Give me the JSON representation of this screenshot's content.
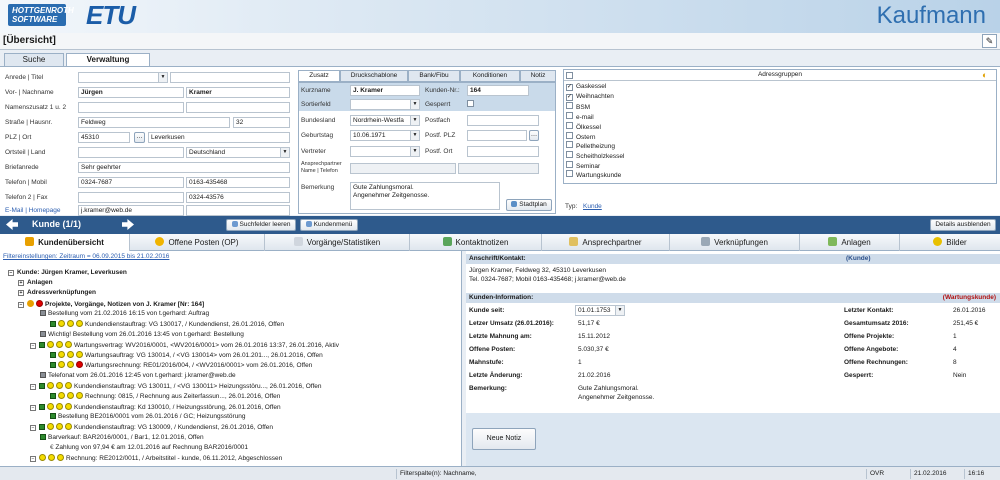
{
  "header": {
    "logo_line1": "HOTTGENROTH",
    "logo_line2": "SOFTWARE",
    "logo_main": "ETU",
    "app_title": "Kaufmann"
  },
  "titlebar": {
    "title": "[Übersicht]"
  },
  "tabs": [
    {
      "label": "Suche"
    },
    {
      "label": "Verwaltung"
    }
  ],
  "form": {
    "anrede_label": "Anrede | Titel",
    "name_label": "Vor- | Nachname",
    "vorname": "Jürgen",
    "nachname": "Kramer",
    "nz_label": "Namenszusatz 1 u. 2",
    "strasse_label": "Straße | Hausnr.",
    "strasse": "Feldweg",
    "hausnr": "32",
    "plz_label": "PLZ | Ort",
    "plz": "45310",
    "ort": "Leverkusen",
    "ortsteil_label": "Ortsteil | Land",
    "land": "Deutschland",
    "briefanrede_label": "Briefanrede",
    "briefanrede": "Sehr geehrter",
    "tel1_label": "Telefon | Mobil",
    "tel1": "0324-7687",
    "mobil": "0163-435468",
    "tel2_label": "Telefon 2 | Fax",
    "fax": "0324-43576",
    "email_label": "E-Mail | Homepage",
    "email": "j.kramer@web.de"
  },
  "mid": {
    "tabs": [
      "Zusatz",
      "Druckschablone",
      "Bank/Fibu",
      "Konditionen",
      "Notiz"
    ],
    "kurzname_label": "Kurzname",
    "kurzname": "J. Kramer",
    "kundennr_label": "Kunden-Nr.:",
    "kundennr": "164",
    "sortierfeld_label": "Sortierfeld",
    "gesperrt_label": "Gesperrt",
    "bundesland_label": "Bundesland",
    "bundesland": "Nordrhein-Westfa",
    "postfach_label": "Postfach",
    "geburtstag_label": "Geburtstag",
    "geburtstag": "10.06.1971",
    "postfplz_label": "Postf. PLZ",
    "vertreter_label": "Vertreter",
    "postfort_label": "Postf. Ort",
    "ansprech_label1": "Ansprechpartner",
    "ansprech_label2": "Name | Telefon",
    "bemerkung_label": "Bemerkung",
    "bemerkung1": "Gute Zahlungsmoral.",
    "bemerkung2": "Angenehmer Zeitgenosse.",
    "stadtplan": "Stadtplan"
  },
  "groups": {
    "title": "Adressgruppen",
    "items": [
      {
        "label": "Gaskessel",
        "checked": true
      },
      {
        "label": "Weihnachten",
        "checked": true
      },
      {
        "label": "BSM",
        "checked": false
      },
      {
        "label": "e-mail",
        "checked": false
      },
      {
        "label": "Ölkessel",
        "checked": false
      },
      {
        "label": "Ostern",
        "checked": false
      },
      {
        "label": "Pelletheizung",
        "checked": false
      },
      {
        "label": "Scheitholzkessel",
        "checked": false
      },
      {
        "label": "Seminar",
        "checked": false
      },
      {
        "label": "Wartungskunde",
        "checked": false
      }
    ],
    "typ_label": "Typ:",
    "typ_value": "Kunde"
  },
  "nav": {
    "kunde": "Kunde (1/1)",
    "clear": "Suchfelder leeren",
    "menu": "Kundenmenü",
    "details": "Details ausblenden"
  },
  "viewtabs": [
    "Kundenübersicht",
    "Offene Posten (OP)",
    "Vorgänge/Statistiken",
    "Kontaktnotizen",
    "Ansprechpartner",
    "Verknüpfungen",
    "Anlagen",
    "Bilder"
  ],
  "tree": {
    "filter": "Filtereinstellungen: Zeitraum = 06.09.2015 bis 21.02.2016",
    "root": "Kunde: Jürgen Kramer, Leverkusen",
    "lines": [
      "Anlagen",
      "Adressverknüpfungen",
      "Projekte, Vorgänge, Notizen von J. Kramer [Nr: 164]",
      "Bestellung vom 21.02.2016 16:15  von t.gerhard: Auftrag",
      "Kundendienstauftrag: VG 130017,  / Kundendienst, 26.01.2016, Offen",
      "Wichtig! Bestellung vom 26.01.2016 13:45  von t.gerhard: Bestellung",
      "Wartungsvertrag: WV2016/0001, <WV2016/0001> vom 26.01.2016 13:37, 26.01.2016, Aktiv",
      "Wartungsauftrag: VG 130014,  / <VG 130014> vom 26.01.201..., 26.01.2016, Offen",
      "Wartungsrechnung: RE01/2016/004,  / <WV2016/0001> vom 26.01.2016, Offen",
      "Telefonat vom 26.01.2016 12:45  von t.gerhard: j.kramer@web.de",
      "Kundendienstauftrag: VG 130011,  / <VG 130011> Heizungsstöru..., 26.01.2016, Offen",
      "Rechnung: 0815,  / Rechnung aus Zeiterfassun..., 26.01.2016, Offen",
      "Kundendienstauftrag: Kd 130010,  / Heizungsstörung, 26.01.2016, Offen",
      "Bestellung BE2016/0001 vom 26.01.2016  / GC; Heizungsstörung",
      "Kundendienstauftrag: VG 130009,  / Kundendienst, 26.01.2016, Offen",
      "Barverkauf: BAR2016/0001,  / Bar1, 12.01.2016, Offen",
      "Zahlung von 97,94 € am 12.01.2016 auf Rechnung BAR2016/0001",
      "Rechnung: RE2012/0011,  / Arbeitstitel - kunde, 06.11.2012, Abgeschlossen"
    ]
  },
  "right": {
    "anschrift_head": "Anschrift/Kontakt:",
    "anschrift_tag": "(Kunde)",
    "addr1": "Jürgen Kramer, Feldweg 32, 45310 Leverkusen",
    "addr2": "Tel. 0324-7687; Mobil 0163-435468; j.kramer@web.de",
    "info_head": "Kunden-Information:",
    "info_tag": "(Wartungskunde)",
    "l_seit": "Kunde seit:",
    "v_seit": "01.01.1753",
    "l_umsatz": "Letzer Umsatz (26.01.2016):",
    "v_umsatz": "51,17 €",
    "l_mahn": "Letzte Mahnung am:",
    "v_mahn": "15.11.2012",
    "l_posten": "Offene Posten:",
    "v_posten": "5.030,37 €",
    "l_stufe": "Mahnstufe:",
    "v_stufe": "1",
    "l_aend": "Letzte Änderung:",
    "v_aend": "21.02.2016",
    "l_bem": "Bemerkung:",
    "v_bem1": "Gute Zahlungsmoral.",
    "v_bem2": "Angenehmer Zeitgenosse.",
    "l_kontakt": "Letzter Kontakt:",
    "v_kontakt": "26.01.2016",
    "l_gesamt": "Gesamtumsatz 2016:",
    "v_gesamt": "251,45 €",
    "l_proj": "Offene Projekte:",
    "v_proj": "1",
    "l_ang": "Offene Angebote:",
    "v_ang": "4",
    "l_rech": "Offene Rechnungen:",
    "v_rech": "8",
    "l_gesp": "Gesperrt:",
    "v_gesp": "Nein",
    "neue_notiz": "Neue Notiz"
  },
  "status": {
    "filter": "Filterspalte(n): Nachname,",
    "ovr": "OVR",
    "date": "21.02.2016",
    "time": "16:16"
  }
}
